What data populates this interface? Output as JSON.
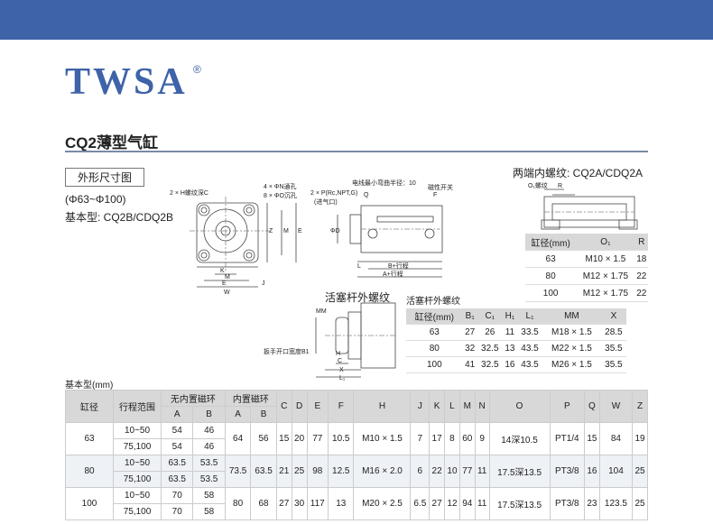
{
  "logo": {
    "text": "TWSA",
    "reg": "®"
  },
  "title": "CQ2薄型气缸",
  "section": "外形尺寸图",
  "notes": {
    "bore_range": "(Φ63~Φ100)",
    "basic_type": "基本型: CQ2B/CDQ2B"
  },
  "both_ends_title": "两端内螺纹: CQ2A/CDQ2A",
  "rod_thread_title": "活塞杆外螺纹",
  "rod_table_title": "活塞杆外螺纹",
  "basic_label": "基本型(mm)",
  "drawing_labels": {
    "h_thread": "2 × H螺纹深C",
    "n_hole": "4 × ΦN通孔",
    "o_counter": "8 × ΦO沉孔",
    "port": "2 × P(Rc,NPT,G)",
    "port_sub": "(进气口)",
    "bend": "电线最小弯曲半径：10",
    "switch": "磁性开关",
    "o1": "O₁螺纹",
    "mm": "MM",
    "wrench": "扳手开口宽度B1",
    "stroke_b": "B+行程",
    "stroke_a": "A+行程",
    "dims": {
      "K": "K",
      "M": "M",
      "E": "E",
      "W": "W",
      "J": "J",
      "Z": "Z",
      "Q": "Q",
      "F": "F",
      "L": "L",
      "R": "R",
      "H": "H",
      "C": "C",
      "X": "X",
      "L1": "L₁",
      "D": "ΦD"
    }
  },
  "both_ends_table": {
    "headers": [
      "缸径(mm)",
      "O₁",
      "R"
    ],
    "rows": [
      [
        "63",
        "M10 × 1.5",
        "18"
      ],
      [
        "80",
        "M12 × 1.75",
        "22"
      ],
      [
        "100",
        "M12 × 1.75",
        "22"
      ]
    ]
  },
  "rod_table": {
    "headers": [
      "缸径(mm)",
      "B₁",
      "C₁",
      "H₁",
      "L₁",
      "MM",
      "X"
    ],
    "rows": [
      [
        "63",
        "27",
        "26",
        "11",
        "33.5",
        "M18 × 1.5",
        "28.5"
      ],
      [
        "80",
        "32",
        "32.5",
        "13",
        "43.5",
        "M22 × 1.5",
        "35.5"
      ],
      [
        "100",
        "41",
        "32.5",
        "16",
        "43.5",
        "M26 × 1.5",
        "35.5"
      ]
    ]
  },
  "main_table": {
    "h_bore": "缸径",
    "h_stroke": "行程范围",
    "h_no_mag": "无内置磁环",
    "h_mag": "内置磁环",
    "h_A": "A",
    "h_B": "B",
    "cols": [
      "C",
      "D",
      "E",
      "F",
      "H",
      "J",
      "K",
      "L",
      "M",
      "N",
      "O",
      "P",
      "Q",
      "W",
      "Z"
    ],
    "groups": [
      {
        "bore": "63",
        "strokes": [
          [
            "10~50",
            "54",
            "46"
          ],
          [
            "75,100",
            "54",
            "46"
          ]
        ],
        "magA": "64",
        "magB": "56",
        "vals": [
          "15",
          "20",
          "77",
          "10.5",
          "M10 × 1.5",
          "7",
          "17",
          "8",
          "60",
          "9",
          "14深10.5",
          "PT1/4",
          "15",
          "84",
          "19"
        ]
      },
      {
        "bore": "80",
        "strokes": [
          [
            "10~50",
            "63.5",
            "53.5"
          ],
          [
            "75,100",
            "63.5",
            "53.5"
          ]
        ],
        "magA": "73.5",
        "magB": "63.5",
        "vals": [
          "21",
          "25",
          "98",
          "12.5",
          "M16 × 2.0",
          "6",
          "22",
          "10",
          "77",
          "11",
          "17.5深13.5",
          "PT3/8",
          "16",
          "104",
          "25"
        ]
      },
      {
        "bore": "100",
        "strokes": [
          [
            "10~50",
            "70",
            "58"
          ],
          [
            "75,100",
            "70",
            "58"
          ]
        ],
        "magA": "80",
        "magB": "68",
        "vals": [
          "27",
          "30",
          "117",
          "13",
          "M20 × 2.5",
          "6.5",
          "27",
          "12",
          "94",
          "11",
          "17.5深13.5",
          "PT3/8",
          "23",
          "123.5",
          "25"
        ]
      }
    ]
  }
}
